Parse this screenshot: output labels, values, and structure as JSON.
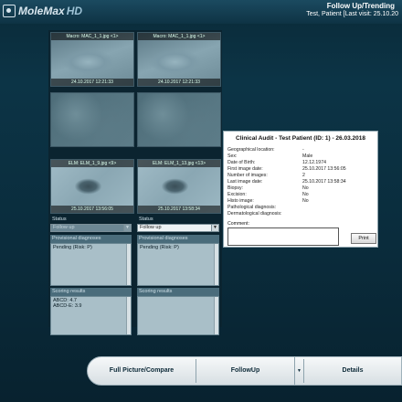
{
  "app": {
    "logo_text": "MoleMax",
    "logo_suffix": "HD"
  },
  "header": {
    "title": "Follow Up/Trending",
    "subtitle": "Test, Patient [Last visit: 25.10.20"
  },
  "thumbnails": [
    {
      "caption": "Macro: MAC_1_1.jpg <1>",
      "timestamp": "24.10.2017 12:21:33",
      "image": "hand"
    },
    {
      "caption": "Macro: MAC_1_1.jpg <1>",
      "timestamp": "24.10.2017 12:21:33",
      "image": "hand"
    },
    {
      "caption": "",
      "timestamp": "",
      "image": "skin"
    },
    {
      "caption": "",
      "timestamp": "",
      "image": "skin"
    },
    {
      "caption": "ELM: ELM_1_9.jpg <9>",
      "timestamp": "25.10.2017 13:56:05",
      "image": "elm"
    },
    {
      "caption": "ELM: ELM_1_13.jpg <13>",
      "timestamp": "25.10.2017 13:58:34",
      "image": "elm"
    }
  ],
  "left_col": {
    "status_label": "Status",
    "status_value": "Follow up",
    "diag_header": "Provisional diagnoses",
    "diag_text": "Pending (Risk: P)",
    "score_header": "Scoring results",
    "score_line1": "ABCD: 4.7",
    "score_line2": "ABCD-E: 3.9"
  },
  "right_col": {
    "status_label": "Status",
    "status_value": "Follow up",
    "diag_header": "Provisional diagnoses",
    "diag_text": "Pending (Risk: P)",
    "score_header": "Scoring results"
  },
  "audit": {
    "title": "Clinical Audit - Test Patient (ID: 1) - 26.03.2018",
    "rows": [
      {
        "label": "Geographical location:",
        "value": "-"
      },
      {
        "label": "Sex:",
        "value": "Male"
      },
      {
        "label": "Date of Birth:",
        "value": "12.12.1974"
      },
      {
        "label": "First image date:",
        "value": "25.10.2017 13:56:05"
      },
      {
        "label": "Number of images:",
        "value": "2"
      },
      {
        "label": "Last image date:",
        "value": "25.10.2017 13:58:34"
      },
      {
        "label": "Biopsy:",
        "value": "No"
      },
      {
        "label": "Excision:",
        "value": "No"
      },
      {
        "label": "Histo image:",
        "value": "No"
      },
      {
        "label": "Pathological diagnosis:",
        "value": ""
      },
      {
        "label": "Dermatological diagnosis:",
        "value": ""
      }
    ],
    "comment_label": "Comment:",
    "print_label": "Print"
  },
  "bottom_bar": {
    "full_picture": "Full Picture/Compare",
    "followup": "FollowUp",
    "details": "Details",
    "dropdown_icon": "chevron-down"
  }
}
